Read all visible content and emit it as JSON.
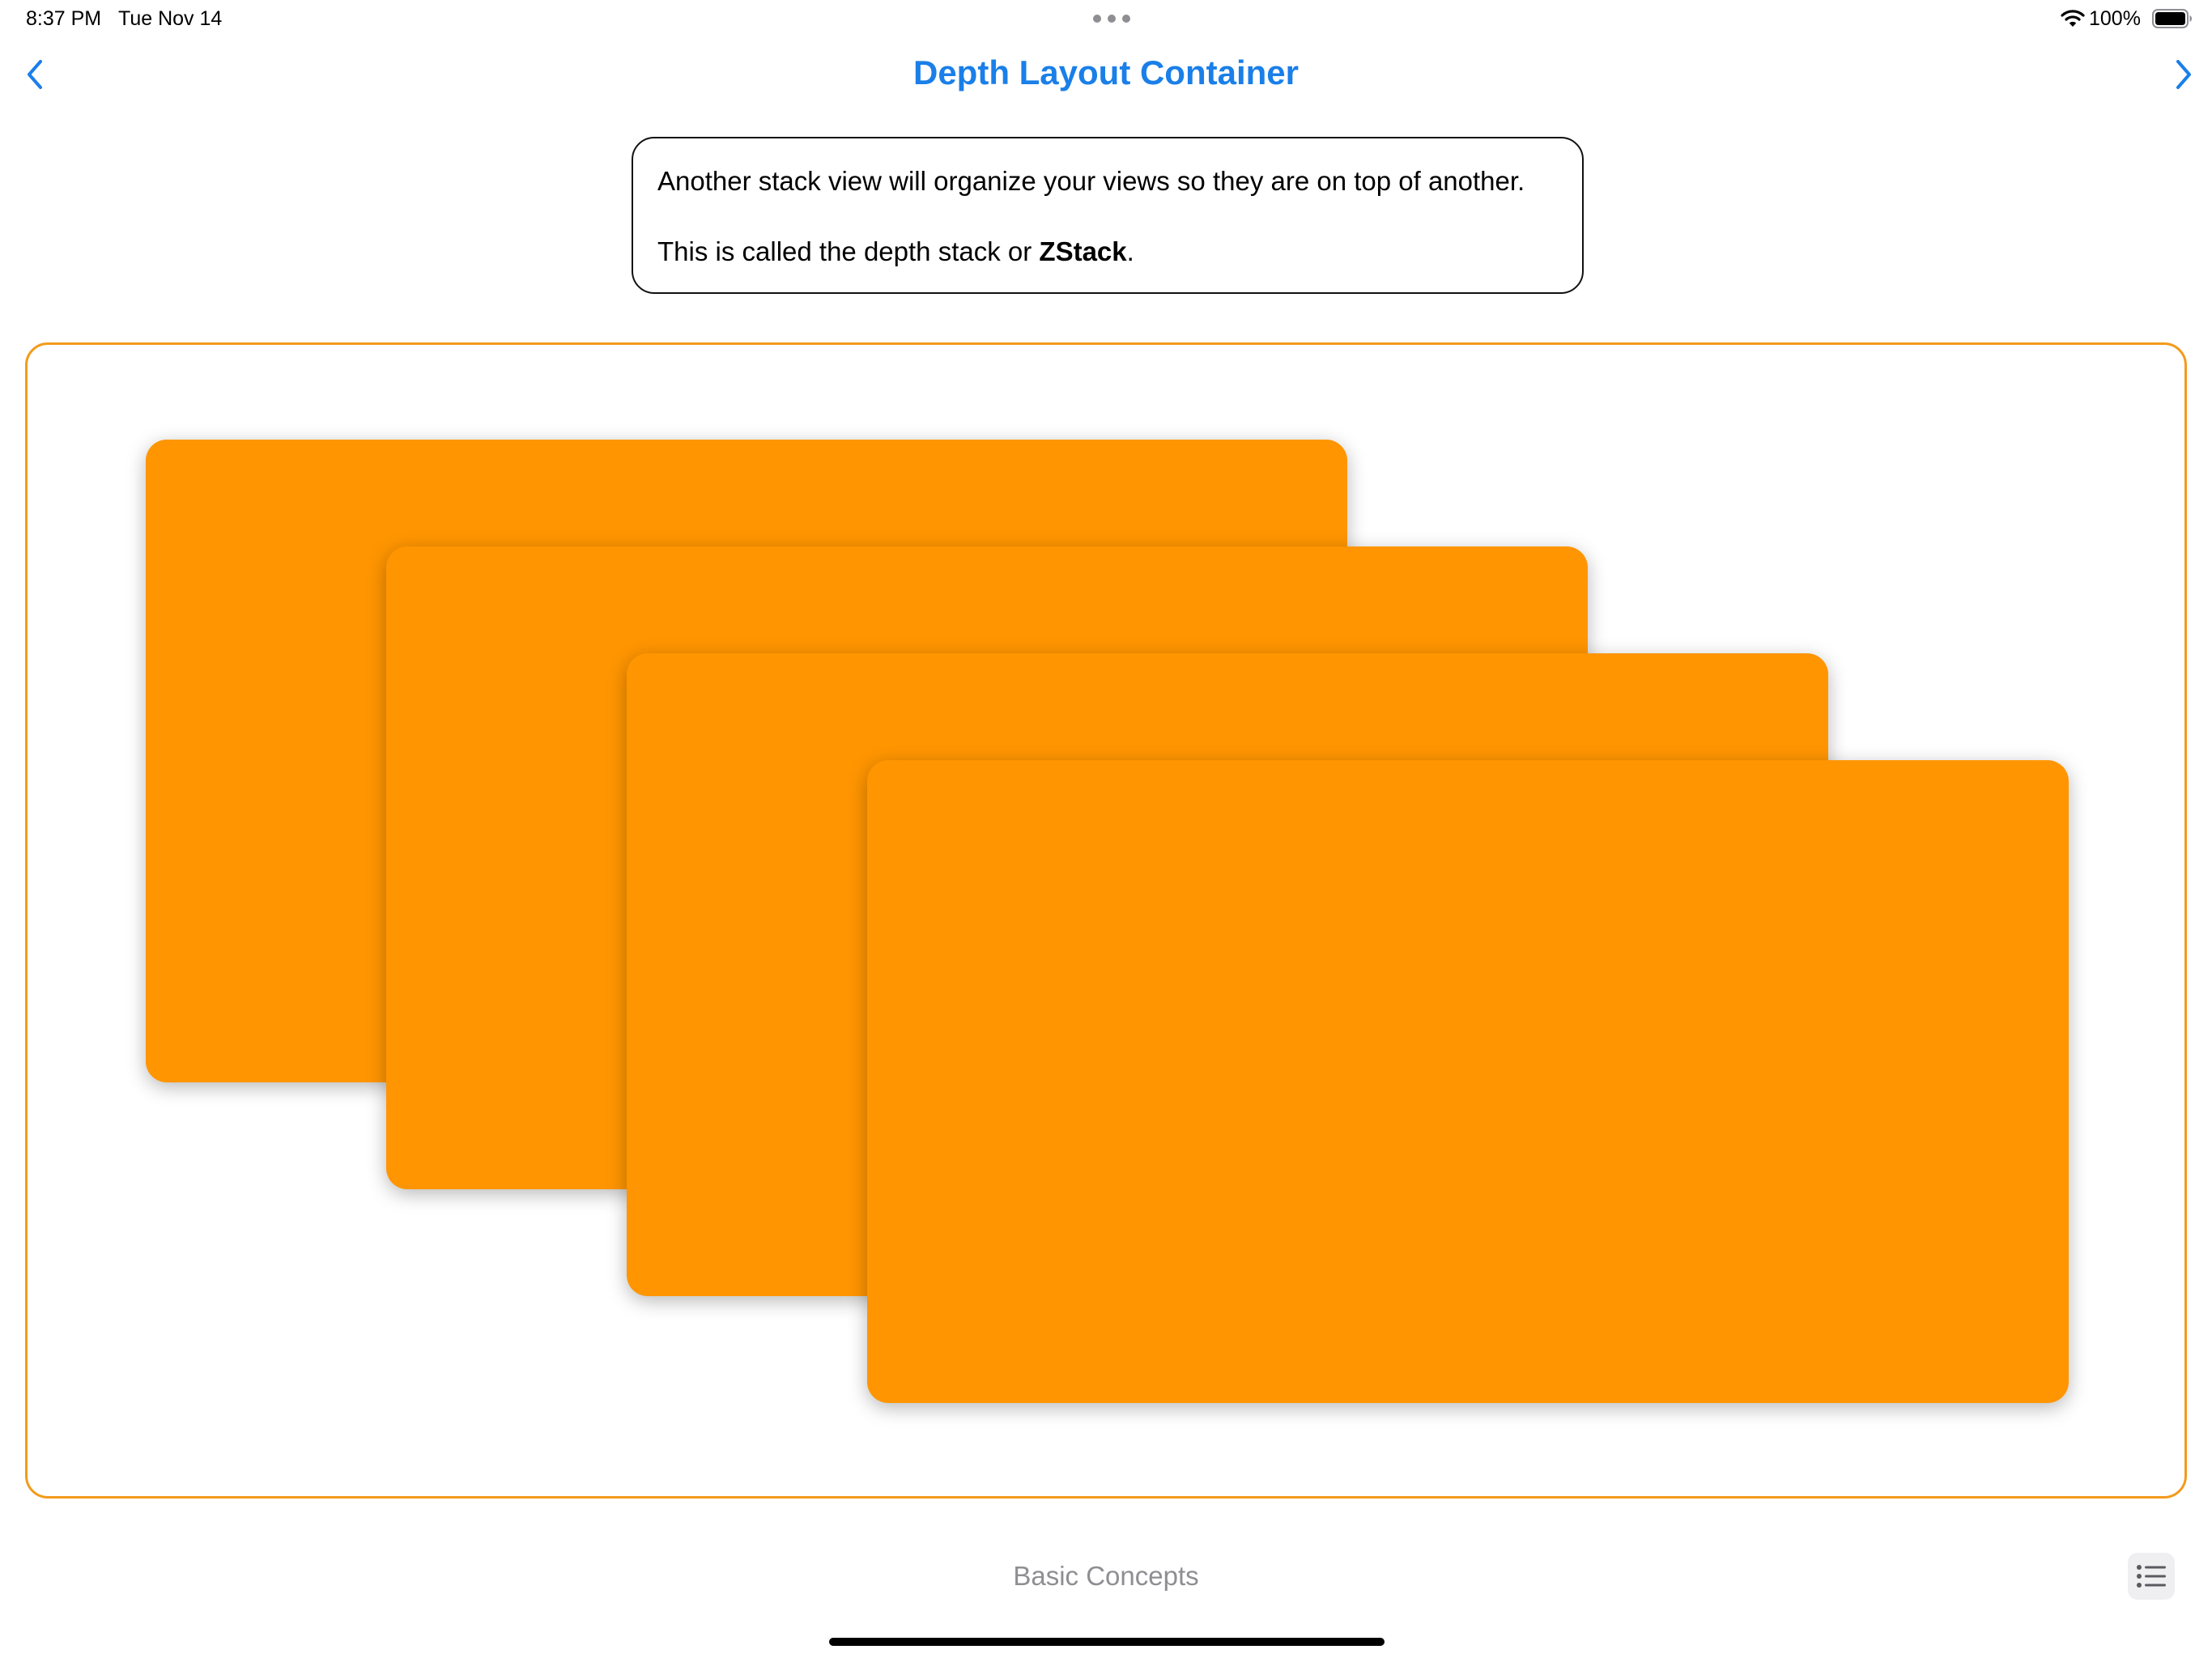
{
  "status_bar": {
    "time": "8:37 PM",
    "date": "Tue Nov 14",
    "battery_percent": "100%",
    "battery_level": 1.0,
    "icons": [
      "multitask-dots-icon",
      "wifi-icon",
      "battery-icon"
    ]
  },
  "nav": {
    "title": "Depth Layout Container",
    "back_icon": "chevron-left-icon",
    "forward_icon": "chevron-right-icon"
  },
  "info": {
    "line1": "Another stack view will organize your views so they are on top of another.",
    "line2_prefix": "This is called the depth stack or ",
    "line2_bold": "ZStack",
    "line2_suffix": "."
  },
  "zstack": {
    "card_count": 4
  },
  "footer": {
    "label": "Basic Concepts",
    "list_icon": "list-icon"
  },
  "colors": {
    "accent": "#1a7fe8",
    "card": "#ff9500",
    "frame_border": "#f39a1c",
    "secondary_text": "#8e8e93"
  }
}
